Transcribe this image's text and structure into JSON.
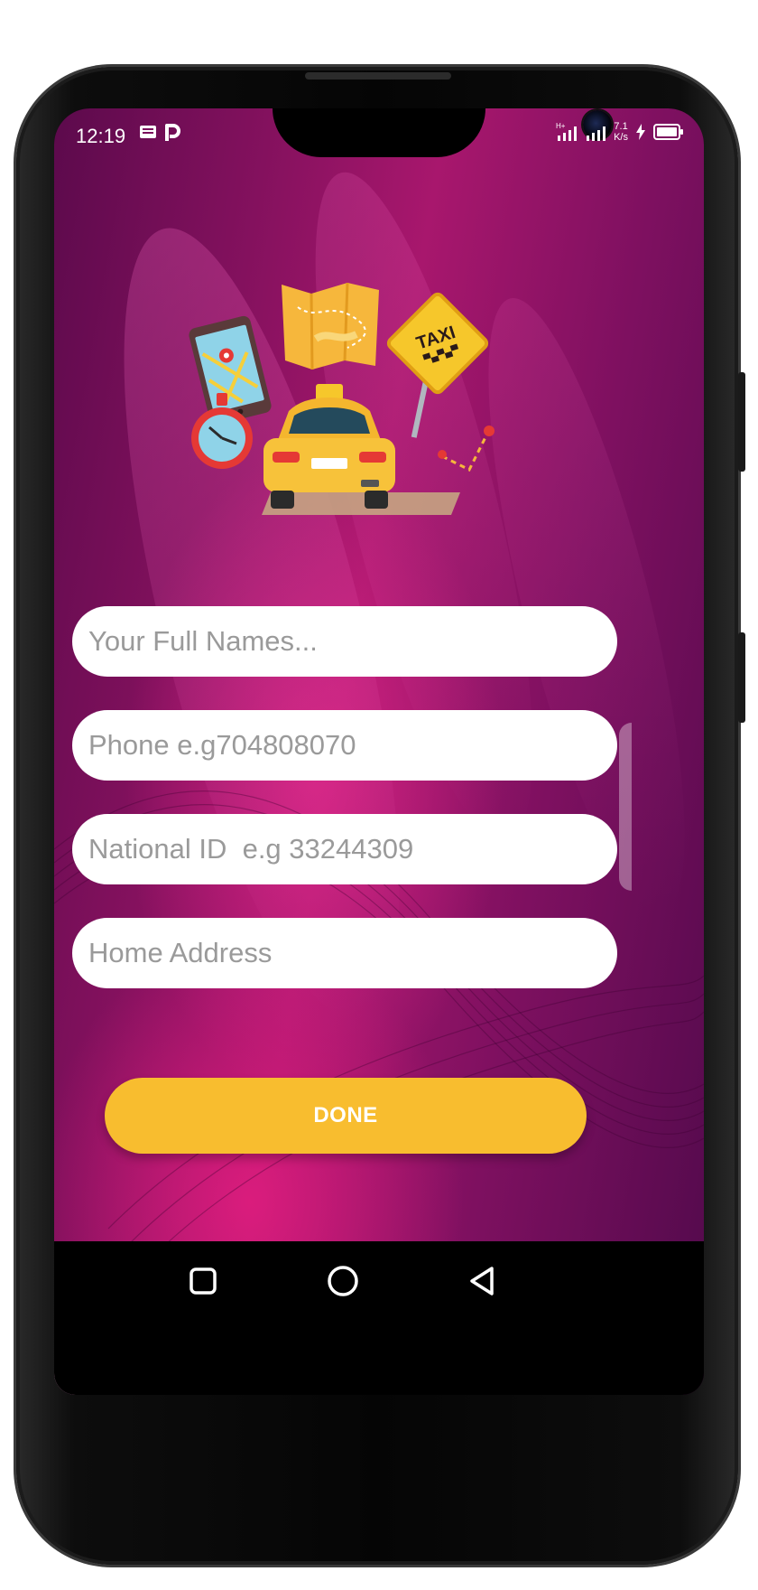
{
  "status_bar": {
    "time": "12:19",
    "left_icons": [
      "message-icon",
      "p-icon"
    ],
    "network": "H+",
    "speed_value": "7.1",
    "speed_unit": "K/s",
    "right_icons": [
      "signal-icon",
      "signal-icon",
      "charging-icon",
      "battery-icon"
    ]
  },
  "illustration": {
    "sign_text": "TAXI",
    "elements": [
      "phone-map-icon",
      "folded-map-icon",
      "taxi-sign-icon",
      "stopwatch-icon",
      "taxi-car-icon",
      "route-icon"
    ]
  },
  "form": {
    "full_names_placeholder": "Your Full Names...",
    "phone_placeholder": "Phone e.g704808070",
    "national_id_placeholder": "National ID  e.g 33244309",
    "home_address_placeholder": "Home Address"
  },
  "done_button": {
    "label": "DONE"
  },
  "nav_bar": {
    "buttons": [
      "recents-button",
      "home-button",
      "back-button"
    ]
  },
  "colors": {
    "accent": "#f8bd2f",
    "background_dark": "#5c0a4c",
    "background_bright": "#e91e7e",
    "field_background": "#ffffff"
  }
}
